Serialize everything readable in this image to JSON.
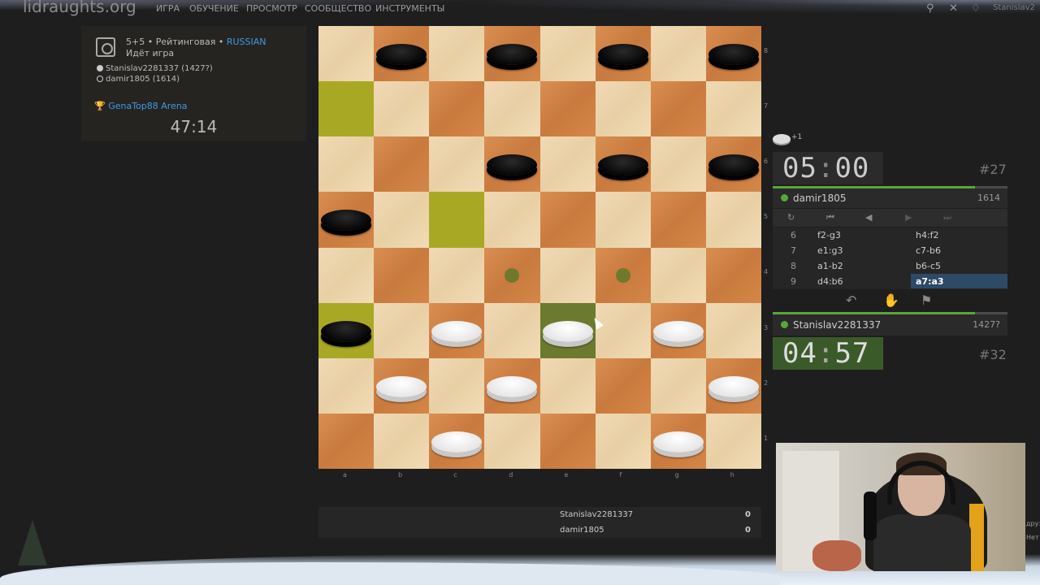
{
  "nav": {
    "logo": "lidraughts.org",
    "items": [
      "ИГРА",
      "ОБУЧЕНИЕ",
      "ПРОСМОТР",
      "СООБЩЕСТВО",
      "ИНСТРУМЕНТЫ"
    ],
    "user": "Stanislav2"
  },
  "game": {
    "mode": "5+5 • Рейтинговая • ",
    "variant": "RUSSIAN",
    "status": "Идёт игра",
    "white_player": "Stanislav2281337 (1427?)",
    "black_player": "damir1805 (1614)",
    "arena": "GenaTop88 Arena",
    "arena_time": "47:14"
  },
  "board": {
    "files": [
      "a",
      "b",
      "c",
      "d",
      "e",
      "f",
      "g",
      "h"
    ],
    "ranks": [
      "8",
      "7",
      "6",
      "5",
      "4",
      "3",
      "2",
      "1"
    ],
    "black_pieces": [
      "b8",
      "d8",
      "f8",
      "h8",
      "d6",
      "f6",
      "h6",
      "a5",
      "a3"
    ],
    "white_pieces": [
      "c3",
      "e3",
      "g3",
      "b2",
      "d2",
      "h2",
      "c1",
      "g1"
    ],
    "highlight_last_move": [
      "a7",
      "c5",
      "a3"
    ],
    "selected": "e3",
    "move_dots": [
      "d4",
      "f4"
    ]
  },
  "opponent": {
    "captured_count": "+1",
    "clock_min": "05",
    "clock_sec": "00",
    "name": "damir1805",
    "rating": "1614",
    "rank": "#27",
    "bar_fraction": 0.86
  },
  "player": {
    "clock_min": "04",
    "clock_sec": "57",
    "name": "Stanislav2281337",
    "rating": "1427?",
    "rank": "#32",
    "bar_fraction": 0.86
  },
  "controls": {
    "flip_icon": "flip-icon",
    "first_icon": "first-icon",
    "prev_icon": "prev-icon",
    "next_icon": "next-icon",
    "last_icon": "last-icon"
  },
  "moves": [
    {
      "num": "6",
      "white": "f2-g3",
      "black": "h4:f2"
    },
    {
      "num": "7",
      "white": "e1:g3",
      "black": "c7-b6"
    },
    {
      "num": "8",
      "white": "a1-b2",
      "black": "b6-c5"
    },
    {
      "num": "9",
      "white": "d4:b6",
      "black": "a7:a3"
    }
  ],
  "score": {
    "rows": [
      {
        "name": "Stanislav2281337",
        "score": "0"
      },
      {
        "name": "damir1805",
        "score": "0"
      }
    ]
  },
  "side_right": [
    "друз",
    "Нет"
  ],
  "colors": {
    "accent_link": "#3d9be0",
    "online": "#5aa63a",
    "active_move": "#2d4a66"
  }
}
